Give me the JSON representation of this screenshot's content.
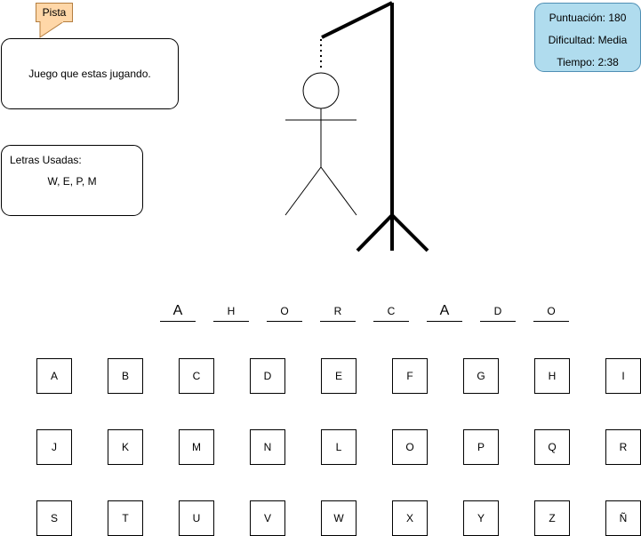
{
  "hint": {
    "tag": "Pista",
    "text": "Juego que estas jugando."
  },
  "used_letters": {
    "title": "Letras Usadas:",
    "letters": "W, E, P, M"
  },
  "stats": {
    "score": "Puntuación: 180",
    "difficulty": "Dificultad: Media",
    "time": "Tiempo: 2:38"
  },
  "word": [
    "A",
    "H",
    "O",
    "R",
    "C",
    "A",
    "D",
    "O"
  ],
  "keyboard": [
    [
      "A",
      "B",
      "C",
      "D",
      "E",
      "F",
      "G",
      "H",
      "I"
    ],
    [
      "J",
      "K",
      "M",
      "N",
      "L",
      "O",
      "P",
      "Q",
      "R"
    ],
    [
      "S",
      "T",
      "U",
      "V",
      "W",
      "X",
      "Y",
      "Z",
      "Ñ"
    ]
  ],
  "colors": {
    "hint_tag_bg": "#ffd7a8",
    "stats_bg": "#b0dcee"
  }
}
